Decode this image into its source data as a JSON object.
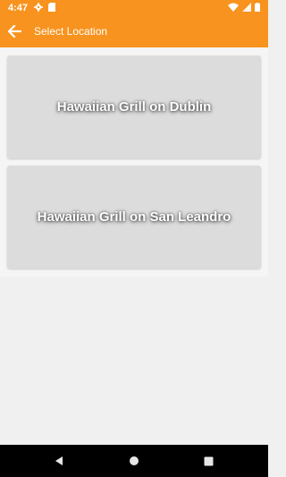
{
  "status_bar": {
    "time": "4:47",
    "icons_left": [
      "gear-icon",
      "sd-card-icon"
    ],
    "icons_right": [
      "wifi-icon",
      "signal-icon",
      "battery-icon"
    ]
  },
  "app_bar": {
    "title": "Select Location",
    "back_icon": "arrow-left-icon",
    "color": "#f7931e"
  },
  "locations": [
    {
      "label": "Hawaiian Grill on Dublin"
    },
    {
      "label": "Hawaiian Grill on San Leandro"
    }
  ],
  "nav_bar": {
    "buttons": [
      "back-triangle-icon",
      "home-circle-icon",
      "recents-square-icon"
    ]
  }
}
